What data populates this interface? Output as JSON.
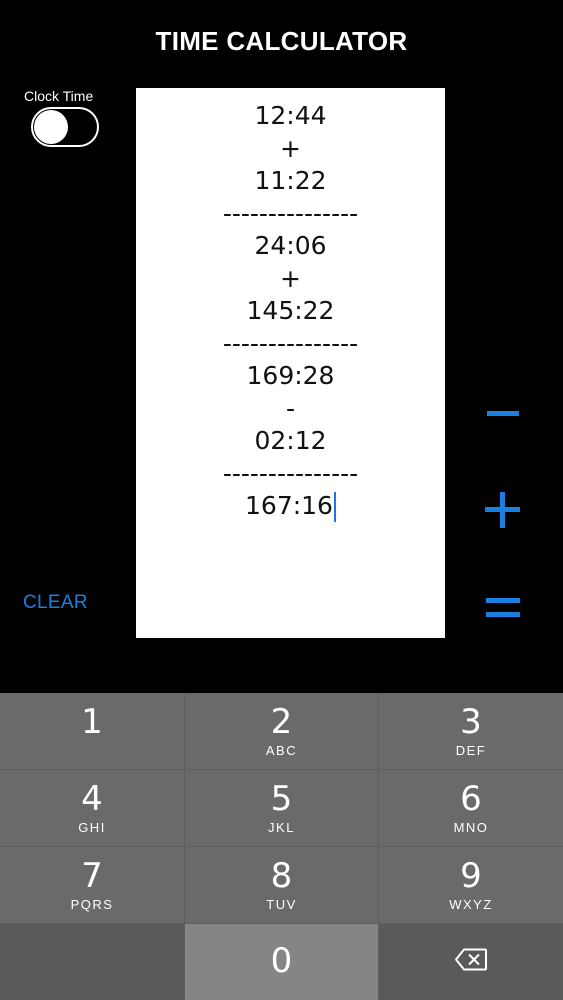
{
  "header": {
    "title": "TIME CALCULATOR"
  },
  "toggle": {
    "label": "Clock Time",
    "on": false
  },
  "tape": {
    "lines": [
      "12:44",
      "+",
      "11:22",
      "---------------",
      "24:06",
      "+",
      "145:22",
      "---------------",
      "169:28",
      "-",
      "02:12",
      "---------------"
    ],
    "result": "167:16"
  },
  "controls": {
    "clear_label": "CLEAR",
    "minus_icon": "minus-icon",
    "plus_icon": "plus-icon",
    "equals_icon": "equals-icon"
  },
  "colors": {
    "accent": "#1a7fe0",
    "background": "#000000",
    "keypad": "#5d5d5f"
  },
  "keypad": {
    "keys": [
      {
        "num": "1",
        "sub": ""
      },
      {
        "num": "2",
        "sub": "ABC"
      },
      {
        "num": "3",
        "sub": "DEF"
      },
      {
        "num": "4",
        "sub": "GHI"
      },
      {
        "num": "5",
        "sub": "JKL"
      },
      {
        "num": "6",
        "sub": "MNO"
      },
      {
        "num": "7",
        "sub": "PQRS"
      },
      {
        "num": "8",
        "sub": "TUV"
      },
      {
        "num": "9",
        "sub": "WXYZ"
      },
      {
        "num": "",
        "sub": ""
      },
      {
        "num": "0",
        "sub": ""
      },
      {
        "num": "",
        "sub": "",
        "icon": "backspace-icon"
      }
    ]
  }
}
